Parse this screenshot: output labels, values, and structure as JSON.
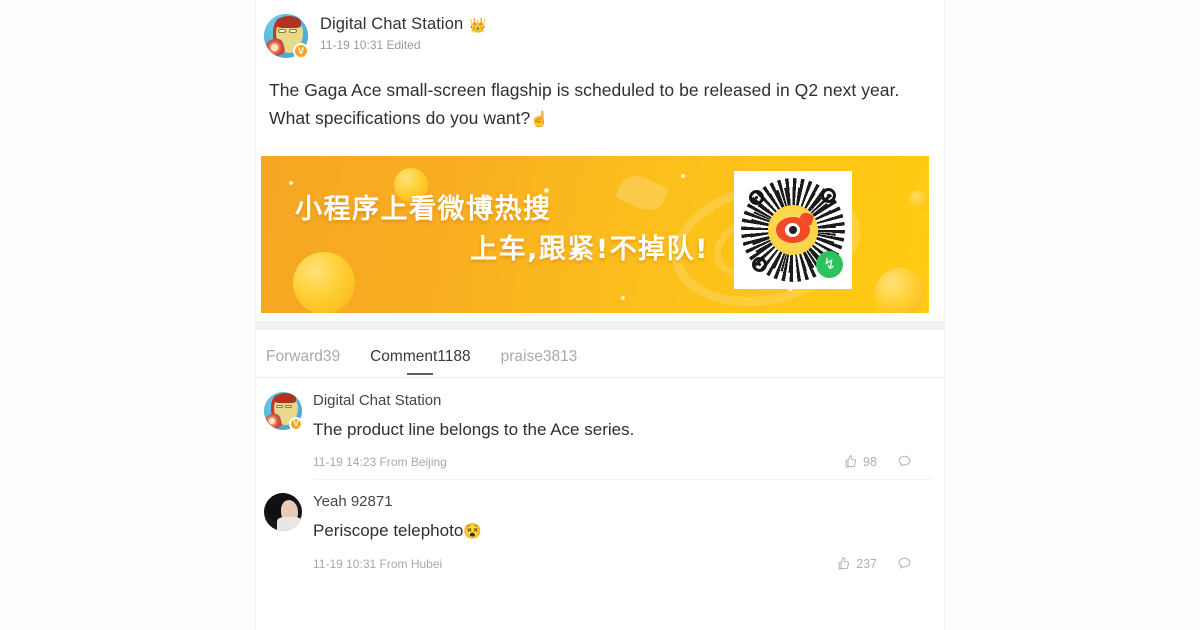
{
  "post": {
    "author": "Digital Chat Station",
    "author_badge_icon": "crown-icon",
    "author_badge_glyph": "👑",
    "verified_badge_letter": "V",
    "timestamp": "11-19 10:31 Edited",
    "text_line1": "The Gaga Ace small-screen flagship is scheduled to be released in Q2 next year.",
    "text_line2": "What specifications do you want?",
    "text_emoji": "☝️"
  },
  "banner": {
    "line1": "小程序上看微博热搜",
    "line2": "上车,跟紧!不掉队!",
    "qr_mini_program_glyph": "↯",
    "colors": {
      "gradient_start": "#f5a623",
      "gradient_end": "#ffcc12",
      "weibo_red": "#f04a28",
      "mini_program_green": "#2ec25e"
    }
  },
  "tabs": [
    {
      "label": "Forward39",
      "active": false
    },
    {
      "label": "Comment1188",
      "active": true
    },
    {
      "label": "praise3813",
      "active": false
    }
  ],
  "comments": [
    {
      "name": "Digital Chat Station",
      "verified_letter": "V",
      "text": "The product line belongs to the Ace series.",
      "meta": "11-19 14:23 From Beijing",
      "likes": "98",
      "avatar_type": "ironman"
    },
    {
      "name": "Yeah 92871",
      "text": "Periscope telephoto",
      "text_emoji": "😵",
      "meta": "11-19 10:31 From Hubei",
      "likes": "237",
      "avatar_type": "photo"
    }
  ]
}
